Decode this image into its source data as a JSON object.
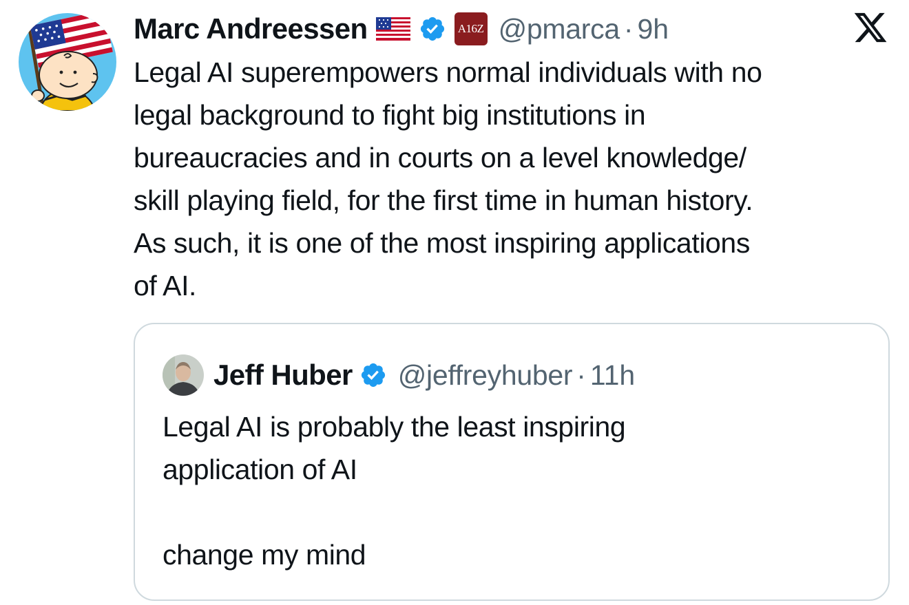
{
  "tweet": {
    "author": {
      "name": "Marc Andreessen",
      "flag_icon": "us-flag-icon",
      "verified_icon": "verified-badge-icon",
      "affiliate_badge": "A16Z",
      "handle": "@pmarca",
      "separator": "·",
      "time": "9h"
    },
    "brand_icon": "x-logo-icon",
    "text": "Legal AI superempowers normal individuals with no\nlegal background to fight big institutions in\nbureaucracies and in courts on a level knowledge/\nskill playing field, for the first time in human history.\nAs such, it is one of the most inspiring applications\nof AI."
  },
  "quote": {
    "author": {
      "name": "Jeff Huber",
      "verified_icon": "verified-badge-icon",
      "handle": "@jeffreyhuber",
      "separator": "·",
      "time": "11h"
    },
    "text": "Legal AI is probably the least inspiring\napplication of AI\n\nchange my mind"
  },
  "colors": {
    "text_primary": "#0f1419",
    "text_secondary": "#536471",
    "verified_blue": "#1d9bf0",
    "card_border": "#cfd9de",
    "a16z_red": "#8a1c1f"
  }
}
